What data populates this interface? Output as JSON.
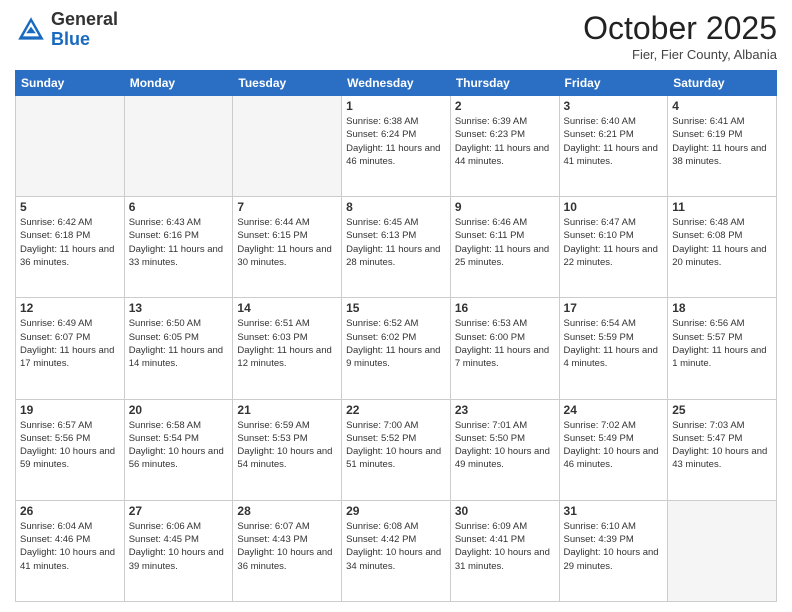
{
  "header": {
    "logo": {
      "general": "General",
      "blue": "Blue"
    },
    "title": "October 2025",
    "location": "Fier, Fier County, Albania"
  },
  "weekdays": [
    "Sunday",
    "Monday",
    "Tuesday",
    "Wednesday",
    "Thursday",
    "Friday",
    "Saturday"
  ],
  "weeks": [
    [
      {
        "day": "",
        "empty": true
      },
      {
        "day": "",
        "empty": true
      },
      {
        "day": "",
        "empty": true
      },
      {
        "day": "1",
        "sunrise": "6:38 AM",
        "sunset": "6:24 PM",
        "daylight": "11 hours and 46 minutes."
      },
      {
        "day": "2",
        "sunrise": "6:39 AM",
        "sunset": "6:23 PM",
        "daylight": "11 hours and 44 minutes."
      },
      {
        "day": "3",
        "sunrise": "6:40 AM",
        "sunset": "6:21 PM",
        "daylight": "11 hours and 41 minutes."
      },
      {
        "day": "4",
        "sunrise": "6:41 AM",
        "sunset": "6:19 PM",
        "daylight": "11 hours and 38 minutes."
      }
    ],
    [
      {
        "day": "5",
        "sunrise": "6:42 AM",
        "sunset": "6:18 PM",
        "daylight": "11 hours and 36 minutes."
      },
      {
        "day": "6",
        "sunrise": "6:43 AM",
        "sunset": "6:16 PM",
        "daylight": "11 hours and 33 minutes."
      },
      {
        "day": "7",
        "sunrise": "6:44 AM",
        "sunset": "6:15 PM",
        "daylight": "11 hours and 30 minutes."
      },
      {
        "day": "8",
        "sunrise": "6:45 AM",
        "sunset": "6:13 PM",
        "daylight": "11 hours and 28 minutes."
      },
      {
        "day": "9",
        "sunrise": "6:46 AM",
        "sunset": "6:11 PM",
        "daylight": "11 hours and 25 minutes."
      },
      {
        "day": "10",
        "sunrise": "6:47 AM",
        "sunset": "6:10 PM",
        "daylight": "11 hours and 22 minutes."
      },
      {
        "day": "11",
        "sunrise": "6:48 AM",
        "sunset": "6:08 PM",
        "daylight": "11 hours and 20 minutes."
      }
    ],
    [
      {
        "day": "12",
        "sunrise": "6:49 AM",
        "sunset": "6:07 PM",
        "daylight": "11 hours and 17 minutes."
      },
      {
        "day": "13",
        "sunrise": "6:50 AM",
        "sunset": "6:05 PM",
        "daylight": "11 hours and 14 minutes."
      },
      {
        "day": "14",
        "sunrise": "6:51 AM",
        "sunset": "6:03 PM",
        "daylight": "11 hours and 12 minutes."
      },
      {
        "day": "15",
        "sunrise": "6:52 AM",
        "sunset": "6:02 PM",
        "daylight": "11 hours and 9 minutes."
      },
      {
        "day": "16",
        "sunrise": "6:53 AM",
        "sunset": "6:00 PM",
        "daylight": "11 hours and 7 minutes."
      },
      {
        "day": "17",
        "sunrise": "6:54 AM",
        "sunset": "5:59 PM",
        "daylight": "11 hours and 4 minutes."
      },
      {
        "day": "18",
        "sunrise": "6:56 AM",
        "sunset": "5:57 PM",
        "daylight": "11 hours and 1 minute."
      }
    ],
    [
      {
        "day": "19",
        "sunrise": "6:57 AM",
        "sunset": "5:56 PM",
        "daylight": "10 hours and 59 minutes."
      },
      {
        "day": "20",
        "sunrise": "6:58 AM",
        "sunset": "5:54 PM",
        "daylight": "10 hours and 56 minutes."
      },
      {
        "day": "21",
        "sunrise": "6:59 AM",
        "sunset": "5:53 PM",
        "daylight": "10 hours and 54 minutes."
      },
      {
        "day": "22",
        "sunrise": "7:00 AM",
        "sunset": "5:52 PM",
        "daylight": "10 hours and 51 minutes."
      },
      {
        "day": "23",
        "sunrise": "7:01 AM",
        "sunset": "5:50 PM",
        "daylight": "10 hours and 49 minutes."
      },
      {
        "day": "24",
        "sunrise": "7:02 AM",
        "sunset": "5:49 PM",
        "daylight": "10 hours and 46 minutes."
      },
      {
        "day": "25",
        "sunrise": "7:03 AM",
        "sunset": "5:47 PM",
        "daylight": "10 hours and 43 minutes."
      }
    ],
    [
      {
        "day": "26",
        "sunrise": "6:04 AM",
        "sunset": "4:46 PM",
        "daylight": "10 hours and 41 minutes."
      },
      {
        "day": "27",
        "sunrise": "6:06 AM",
        "sunset": "4:45 PM",
        "daylight": "10 hours and 39 minutes."
      },
      {
        "day": "28",
        "sunrise": "6:07 AM",
        "sunset": "4:43 PM",
        "daylight": "10 hours and 36 minutes."
      },
      {
        "day": "29",
        "sunrise": "6:08 AM",
        "sunset": "4:42 PM",
        "daylight": "10 hours and 34 minutes."
      },
      {
        "day": "30",
        "sunrise": "6:09 AM",
        "sunset": "4:41 PM",
        "daylight": "10 hours and 31 minutes."
      },
      {
        "day": "31",
        "sunrise": "6:10 AM",
        "sunset": "4:39 PM",
        "daylight": "10 hours and 29 minutes."
      },
      {
        "day": "",
        "empty": true
      }
    ]
  ]
}
